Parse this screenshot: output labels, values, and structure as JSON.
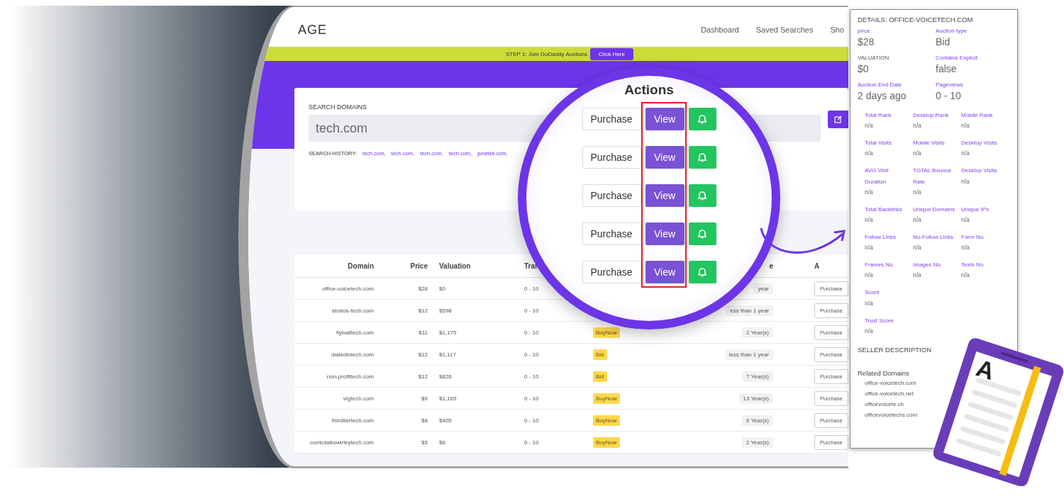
{
  "screen": {
    "logo": "AGE",
    "nav": [
      "Dashboard",
      "Saved Searches",
      "Sho"
    ],
    "banner": {
      "text": "STEP 1: Join GoDaddy Auctions",
      "button": "Click Here"
    },
    "search": {
      "label": "SEARCH DOMAINS",
      "value": "tech.com",
      "history_label": "SEARCH HISTORY:",
      "history": [
        "tech.com,",
        "tech.com,",
        "tech.com,",
        "tech.com,",
        "junetek.com,"
      ]
    },
    "table": {
      "columns": [
        "Domain",
        "Price",
        "Valuation",
        "Traf",
        "e",
        "A"
      ],
      "rows": [
        {
          "domain": "office-voicetech.com",
          "price": "$28",
          "valuation": "$0",
          "traffic": "0 - 10",
          "age": "year",
          "action": "Purchase"
        },
        {
          "domain": "stratos-tech.com",
          "price": "$12",
          "valuation": "$598",
          "traffic": "0 - 10",
          "age": "ess than 1 year",
          "action": "Purchase"
        },
        {
          "domain": "flyballtech.com",
          "price": "$11",
          "valuation": "$1,175",
          "traffic": "0 - 10",
          "type": "BuyNow",
          "age": "2 Year(s)",
          "action": "Purchase"
        },
        {
          "domain": "dialedintech.com",
          "price": "$12",
          "valuation": "$1,117",
          "traffic": "0 - 10",
          "type": "Bid",
          "age": "less than 1 year",
          "action": "Purchase"
        },
        {
          "domain": "non-profittech.com",
          "price": "$12",
          "valuation": "$826",
          "traffic": "0 - 10",
          "type": "Bid",
          "age": "7 Year(s)",
          "action": "Purchase"
        },
        {
          "domain": "vtgtech.com",
          "price": "$9",
          "valuation": "$1,165",
          "traffic": "0 - 10",
          "type": "BuyNow",
          "age": "13 Year(s)",
          "action": "Purchase"
        },
        {
          "domain": "thirdtiertech.com",
          "price": "$8",
          "valuation": "$405",
          "traffic": "0 - 10",
          "type": "BuyNow",
          "age": "6 Year(s)",
          "action": "Purchase"
        },
        {
          "domain": "comictalkswirleytech.com",
          "price": "$5",
          "valuation": "$6",
          "traffic": "0 - 10",
          "type": "BuyNow",
          "age": "2 Year(s)",
          "action": "Purchase"
        }
      ]
    }
  },
  "magnifier": {
    "title": "Actions",
    "rows": [
      {
        "purchase": "Purchase",
        "view": "View"
      },
      {
        "purchase": "Purchase",
        "view": "View"
      },
      {
        "purchase": "Purchase",
        "view": "View"
      },
      {
        "purchase": "Purchase",
        "view": "View"
      },
      {
        "purchase": "Purchase",
        "view": "View"
      }
    ]
  },
  "details": {
    "title": "DETAILS: OFFICE-VOICETECH.COM",
    "main_fields": [
      {
        "label": "price",
        "value": "$28",
        "kind": "accent"
      },
      {
        "label": "Auction type",
        "value": "Bid",
        "kind": "accent"
      },
      {
        "label": "VALUATION",
        "value": "$0",
        "kind": "plain"
      },
      {
        "label": "Contains Explicit",
        "value": "false",
        "kind": "accent"
      },
      {
        "label": "Auction End Date",
        "value": "2 days ago",
        "kind": "accent"
      },
      {
        "label": "Pageviews",
        "value": "0 - 10",
        "kind": "accent"
      }
    ],
    "metric_rows": [
      [
        {
          "label": "Total Rank",
          "value": "n/a"
        },
        {
          "label": "Desktop Rank",
          "value": "n/a"
        },
        {
          "label": "Mobile Rank",
          "value": "n/a"
        }
      ],
      [
        {
          "label": "Total Visits",
          "value": "n/a"
        },
        {
          "label": "Mobile Visits",
          "value": "n/a"
        },
        {
          "label": "Desktop Visits",
          "value": "n/a"
        }
      ],
      [
        {
          "label": "AVG Visit Duration",
          "value": "n/a"
        },
        {
          "label": "TOTAL Bounce Rate",
          "value": "n/a"
        },
        {
          "label": "Desktop Visits",
          "value": "n/a"
        }
      ],
      [
        {
          "label": "Total Backlinks",
          "value": "n/a"
        },
        {
          "label": "Unique Domains",
          "value": "n/a"
        },
        {
          "label": "Unique IPs",
          "value": "n/a"
        }
      ],
      [
        {
          "label": "Follow Links",
          "value": "n/a"
        },
        {
          "label": "No-Follow Links",
          "value": "n/a"
        },
        {
          "label": "Form No.",
          "value": "n/a"
        }
      ],
      [
        {
          "label": "Frames No.",
          "value": "n/a"
        },
        {
          "label": "Images No.",
          "value": "n/a"
        },
        {
          "label": "Texts No.",
          "value": "n/a"
        }
      ],
      [
        {
          "label": "Score",
          "value": "n/a"
        }
      ],
      [
        {
          "label": "Trust Score",
          "value": "n/a"
        }
      ]
    ],
    "seller_heading": "SELLER DESCRIPTION",
    "related_heading": "Related Domains",
    "related": [
      "office-voicetech.com",
      "office-voicetech.net",
      "officevoicete.ch",
      "officevoicetechs.com"
    ]
  },
  "illustration_letter": "A"
}
